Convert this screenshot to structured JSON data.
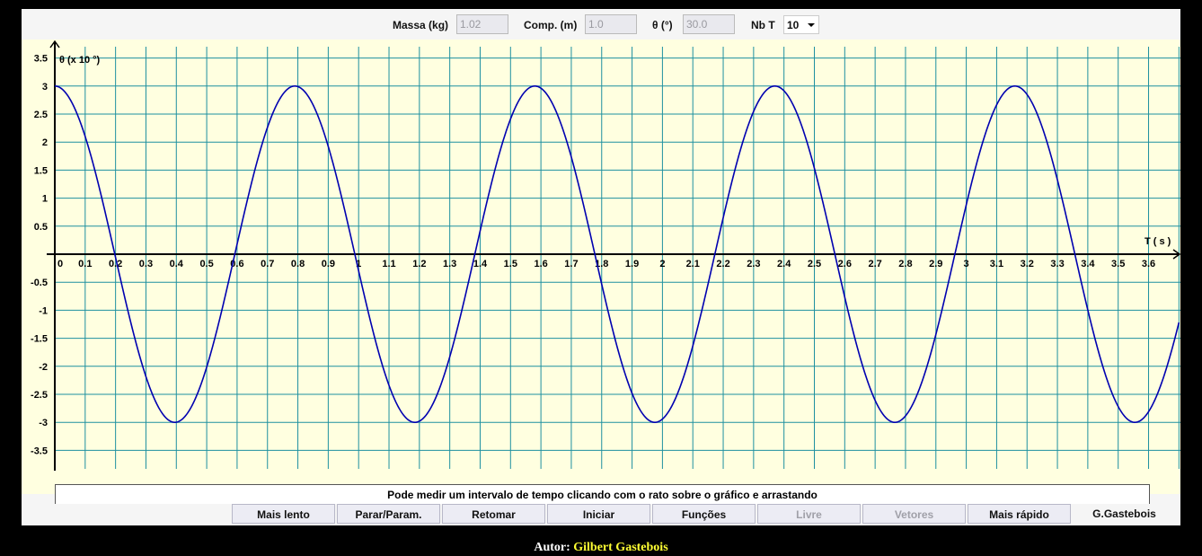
{
  "topbar": {
    "mass_label": "Massa (kg)",
    "mass_value": "1.02",
    "length_label": "Comp. (m)",
    "length_value": "1.0",
    "angle_label": "θ (°)",
    "angle_value": "30.0",
    "nbt_label": "Nb T",
    "nbt_selected": "10"
  },
  "info_text": "Pode medir um intervalo de tempo clicando com o rato sobre o gráfico e arrastando",
  "buttons": [
    {
      "label": "Mais lento",
      "enabled": true
    },
    {
      "label": "Parar/Param.",
      "enabled": true
    },
    {
      "label": "Retomar",
      "enabled": true
    },
    {
      "label": "Iniciar",
      "enabled": true
    },
    {
      "label": "Funções",
      "enabled": true
    },
    {
      "label": "Livre",
      "enabled": false
    },
    {
      "label": "Vetores",
      "enabled": false
    },
    {
      "label": "Mais rápido",
      "enabled": true
    },
    {
      "label": "G.Gastebois",
      "enabled": true
    }
  ],
  "footer": {
    "label": "Autor:",
    "author": "Gilbert Gastebois"
  },
  "colors": {
    "grid": "#1e90a0",
    "curve": "#0000b0",
    "plot_bg": "#ffffe0"
  },
  "chart_data": {
    "type": "line",
    "ylabel": "θ (x 10 °)",
    "xlabel": "T ( s )",
    "x_ticks": [
      "0",
      "0.1",
      "0.2",
      "0.3",
      "0.4",
      "0.5",
      "0.6",
      "0.7",
      "0.8",
      "0.9",
      "1",
      "1.1",
      "1.2",
      "1.3",
      "1.4",
      "1.5",
      "1.6",
      "1.7",
      "1.8",
      "1.9",
      "2",
      "2.1",
      "2.2",
      "2.3",
      "2.4",
      "2.5",
      "2.6",
      "2.7",
      "2.8",
      "2.9",
      "3",
      "3.1",
      "3.2",
      "3.3",
      "3.4",
      "3.5",
      "3.6"
    ],
    "y_ticks": [
      "3.5",
      "3",
      "2.5",
      "2",
      "1.5",
      "1",
      "0.5",
      "-0.5",
      "-1",
      "-1.5",
      "-2",
      "-2.5",
      "-3",
      "-3.5"
    ],
    "xlim": [
      0,
      3.7
    ],
    "ylim": [
      -3.5,
      3.5
    ],
    "grid": true,
    "series": [
      {
        "amplitude": 3.0,
        "period": 0.79,
        "phase": 0,
        "x_range": [
          0,
          3.7
        ]
      }
    ]
  }
}
